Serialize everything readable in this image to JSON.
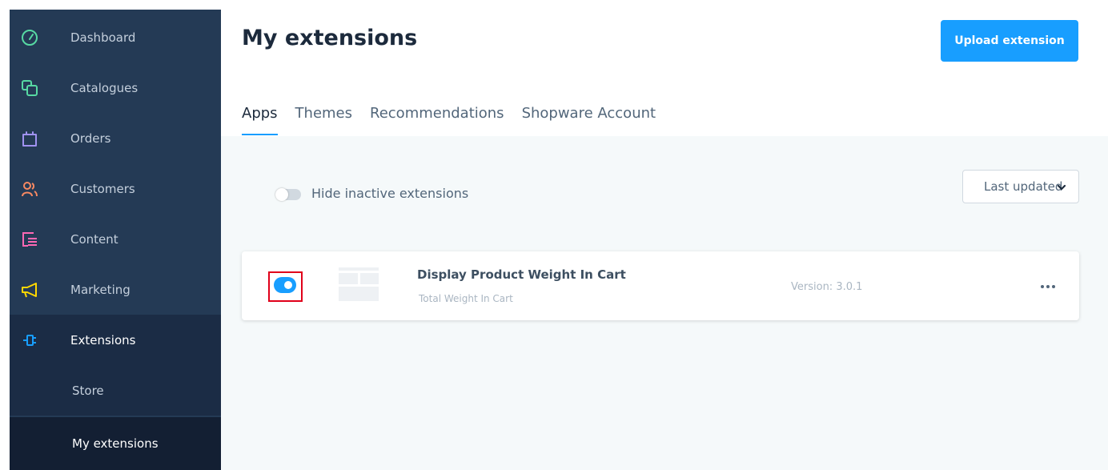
{
  "sidebar": {
    "items": [
      {
        "label": "Dashboard",
        "icon": "dashboard-gauge-icon"
      },
      {
        "label": "Catalogues",
        "icon": "catalogues-icon"
      },
      {
        "label": "Orders",
        "icon": "shopping-bag-icon"
      },
      {
        "label": "Customers",
        "icon": "customers-icon"
      },
      {
        "label": "Content",
        "icon": "content-icon"
      },
      {
        "label": "Marketing",
        "icon": "megaphone-icon"
      },
      {
        "label": "Extensions",
        "icon": "plug-icon"
      }
    ],
    "subitems": [
      {
        "label": "Store"
      },
      {
        "label": "My extensions"
      }
    ]
  },
  "header": {
    "title": "My extensions",
    "upload_label": "Upload extension"
  },
  "tabs": [
    {
      "label": "Apps",
      "active": true
    },
    {
      "label": "Themes"
    },
    {
      "label": "Recommendations"
    },
    {
      "label": "Shopware Account"
    }
  ],
  "filters": {
    "hide_inactive_label": "Hide inactive extensions",
    "hide_inactive_enabled": false,
    "sort_value": "Last updated"
  },
  "extensions": [
    {
      "name": "Display Product Weight In Cart",
      "description": "Total Weight In Cart",
      "version": "Version: 3.0.1",
      "active": true
    }
  ],
  "colors": {
    "sidebar_bg": "#243a55",
    "accent": "#189eff",
    "dashboard": "#57d9a3",
    "catalogues": "#57d9a3",
    "orders": "#a092f0",
    "customers": "#f88962",
    "content": "#ff68b4",
    "marketing": "#ffd700",
    "extensions": "#189eff",
    "highlight": "#e0001a"
  }
}
